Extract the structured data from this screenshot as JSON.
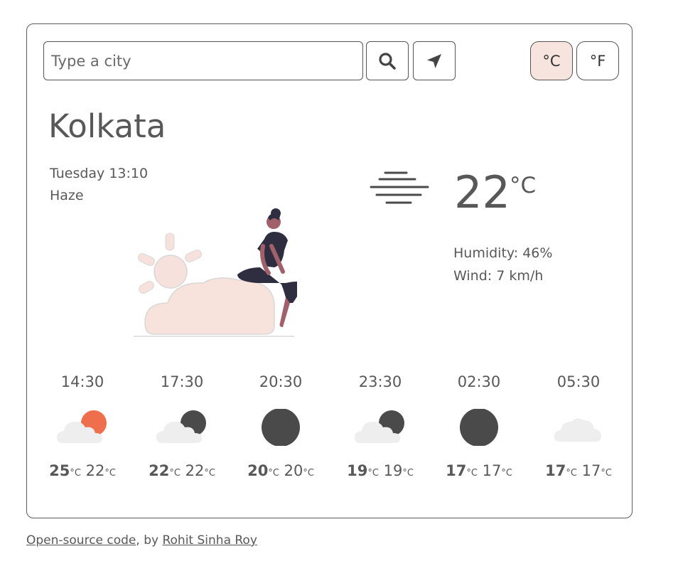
{
  "search": {
    "placeholder": "Type a city"
  },
  "buttons": {
    "search_icon": "search-icon",
    "location_icon": "location-arrow-icon"
  },
  "units": {
    "celsius_label": "°C",
    "fahrenheit_label": "°F",
    "active": "celsius"
  },
  "current": {
    "city": "Kolkata",
    "datetime": "Tuesday 13:10",
    "description": "Haze",
    "temperature": "22",
    "unit": "°C",
    "humidity": "Humidity: 46%",
    "wind": "Wind: 7 km/h",
    "condition_icon": "haze-icon"
  },
  "forecast": [
    {
      "time": "14:30",
      "icon": "partly-cloudy-day-icon",
      "max": "25",
      "min": "22",
      "unit": "°C"
    },
    {
      "time": "17:30",
      "icon": "partly-cloudy-night-icon",
      "max": "22",
      "min": "22",
      "unit": "°C"
    },
    {
      "time": "20:30",
      "icon": "clear-night-icon",
      "max": "20",
      "min": "20",
      "unit": "°C"
    },
    {
      "time": "23:30",
      "icon": "partly-cloudy-night-icon",
      "max": "19",
      "min": "19",
      "unit": "°C"
    },
    {
      "time": "02:30",
      "icon": "clear-night-icon",
      "max": "17",
      "min": "17",
      "unit": "°C"
    },
    {
      "time": "05:30",
      "icon": "cloudy-icon",
      "max": "17",
      "min": "17",
      "unit": "°C"
    }
  ],
  "footer": {
    "code_link": "Open-source code",
    "by_text": ", by ",
    "author_link": "Rohit Sinha Roy"
  },
  "colors": {
    "accent_bg": "#f8e4df",
    "text": "#585858",
    "sun": "#ef6e4b",
    "moon": "#4a4a4a",
    "cloud": "#eeeeee"
  }
}
